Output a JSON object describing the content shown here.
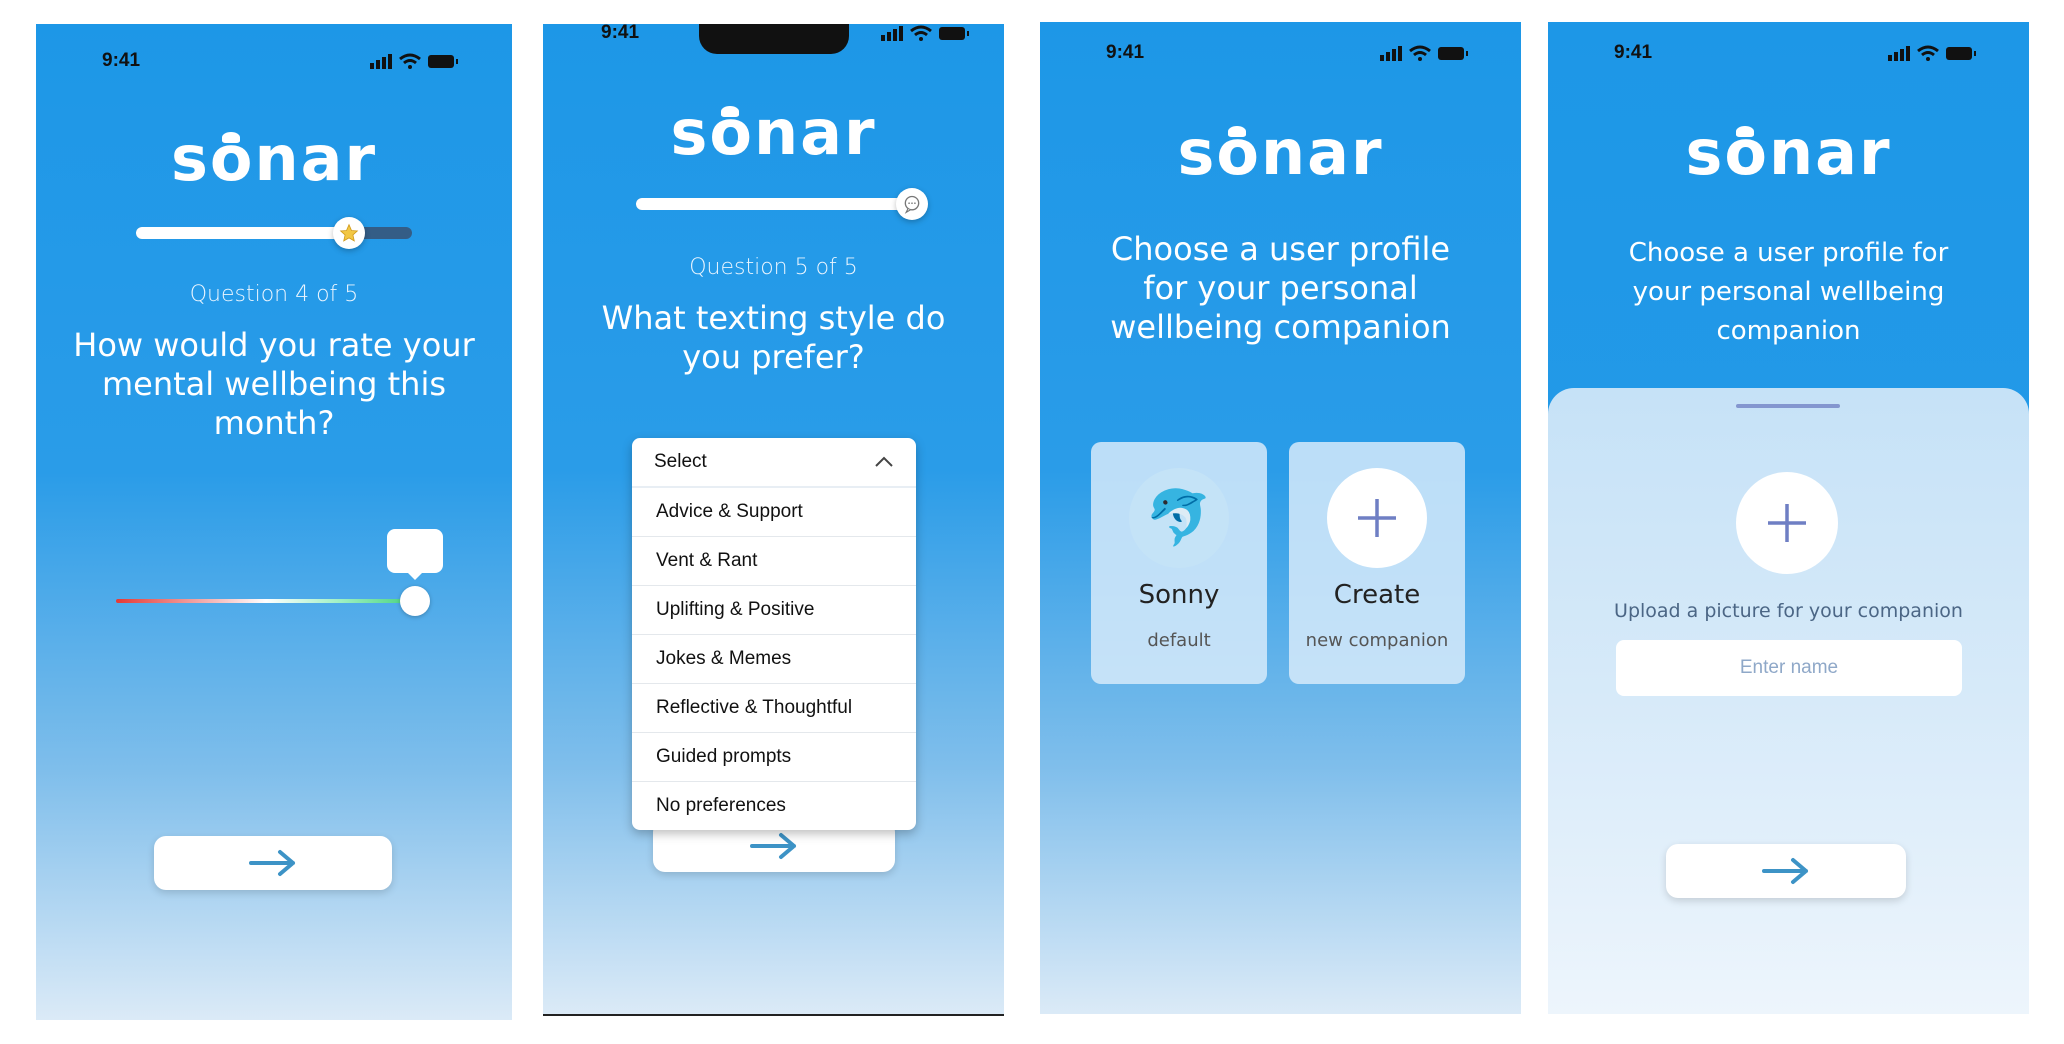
{
  "status_bar": {
    "time": "9:41"
  },
  "app": {
    "logo": "sonar",
    "logo_prefix": "s",
    "logo_o": "o",
    "logo_suffix": "nar"
  },
  "screen1": {
    "question_number": "Question 4 of 5",
    "question": "How would you rate your mental wellbeing this month?",
    "progress_fraction": 0.77,
    "progress_icon": "star-icon",
    "slider_value_fraction": 1.0,
    "slider_emoji": "😆",
    "slider_gradient_colors": [
      "#e53935",
      "#ffffff",
      "#43d17a"
    ]
  },
  "screen2": {
    "question_number": "Question 5 of 5",
    "question": "What texting style do you prefer?",
    "progress_fraction": 1.0,
    "progress_icon": "chat-bubble-icon",
    "select_value": "Select",
    "options": [
      "Advice & Support",
      "Vent & Rant",
      "Uplifting & Positive",
      "Jokes & Memes",
      "Reflective & Thoughtful",
      "Guided prompts",
      "No preferences"
    ]
  },
  "screen3": {
    "heading": "Choose a user profile for your personal wellbeing companion",
    "profiles": [
      {
        "name": "Sonny",
        "subtitle": "default",
        "icon": "dolphin-icon",
        "emoji": "🐬"
      },
      {
        "name": "Create",
        "subtitle": "new companion",
        "icon": "plus-icon"
      }
    ]
  },
  "screen4": {
    "heading": "Choose a user profile for your personal wellbeing companion",
    "upload_label": "Upload a picture for your companion",
    "name_placeholder": "Enter name"
  },
  "colors": {
    "primary": "#1d97e7",
    "arrow": "#3d93c6",
    "plus": "#6f7fc4"
  }
}
